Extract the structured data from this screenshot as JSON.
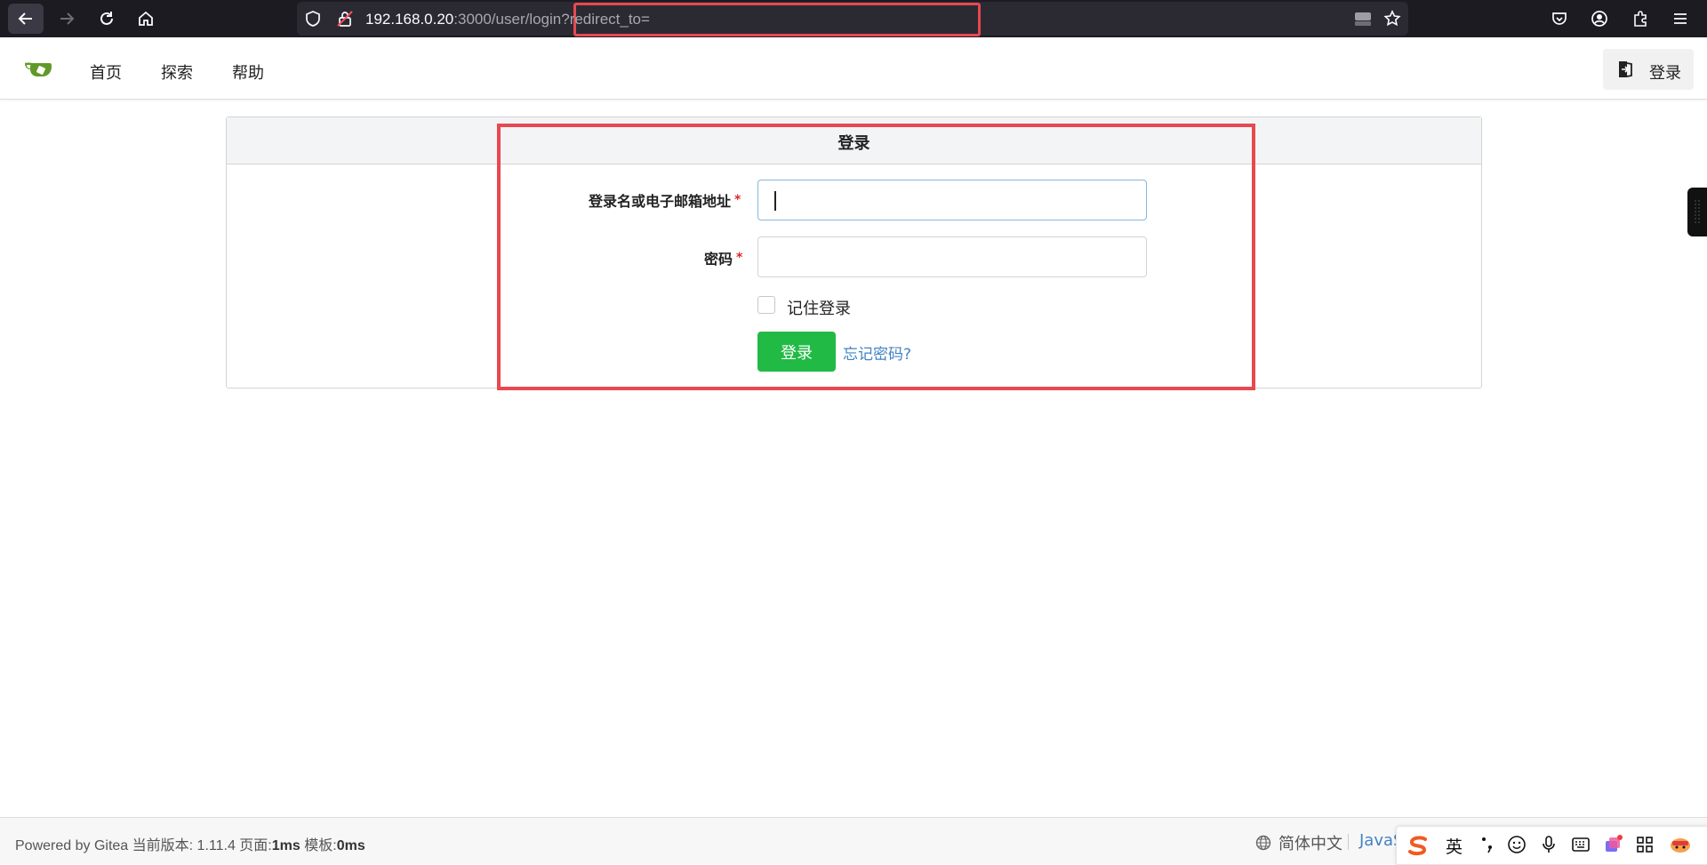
{
  "browser": {
    "url_host": "192.168.0.20",
    "url_rest": ":3000/user/login?redirect_to=",
    "icons": [
      "back-arrow-icon",
      "forward-arrow-icon",
      "reload-icon",
      "home-icon",
      "shield-icon",
      "insecure-lock-icon",
      "drive-icon",
      "star-icon",
      "pocket-icon",
      "account-icon",
      "extensions-icon",
      "menu-icon"
    ]
  },
  "header": {
    "nav": [
      "首页",
      "探索",
      "帮助"
    ],
    "signin_label": "登录"
  },
  "login": {
    "title": "登录",
    "username_label": "登录名或电子邮箱地址",
    "password_label": "密码",
    "required_mark": "*",
    "remember_label": "记住登录",
    "submit_label": "登录",
    "forgot_label": "忘记密码?",
    "username_value": "",
    "password_value": ""
  },
  "footer": {
    "powered": "Powered by Gitea",
    "version_label": "当前版本:",
    "version": "1.11.4",
    "page_label": "页面:",
    "page_time": "1ms",
    "template_label": "模板:",
    "template_time": "0ms",
    "language": "简体中文",
    "js_link": "JavaS"
  },
  "ime": {
    "mode": "英"
  },
  "colors": {
    "annotation": "#e8484f",
    "primary_green": "#21ba45",
    "link_blue": "#4183c4",
    "gitea_green": "#609926"
  }
}
